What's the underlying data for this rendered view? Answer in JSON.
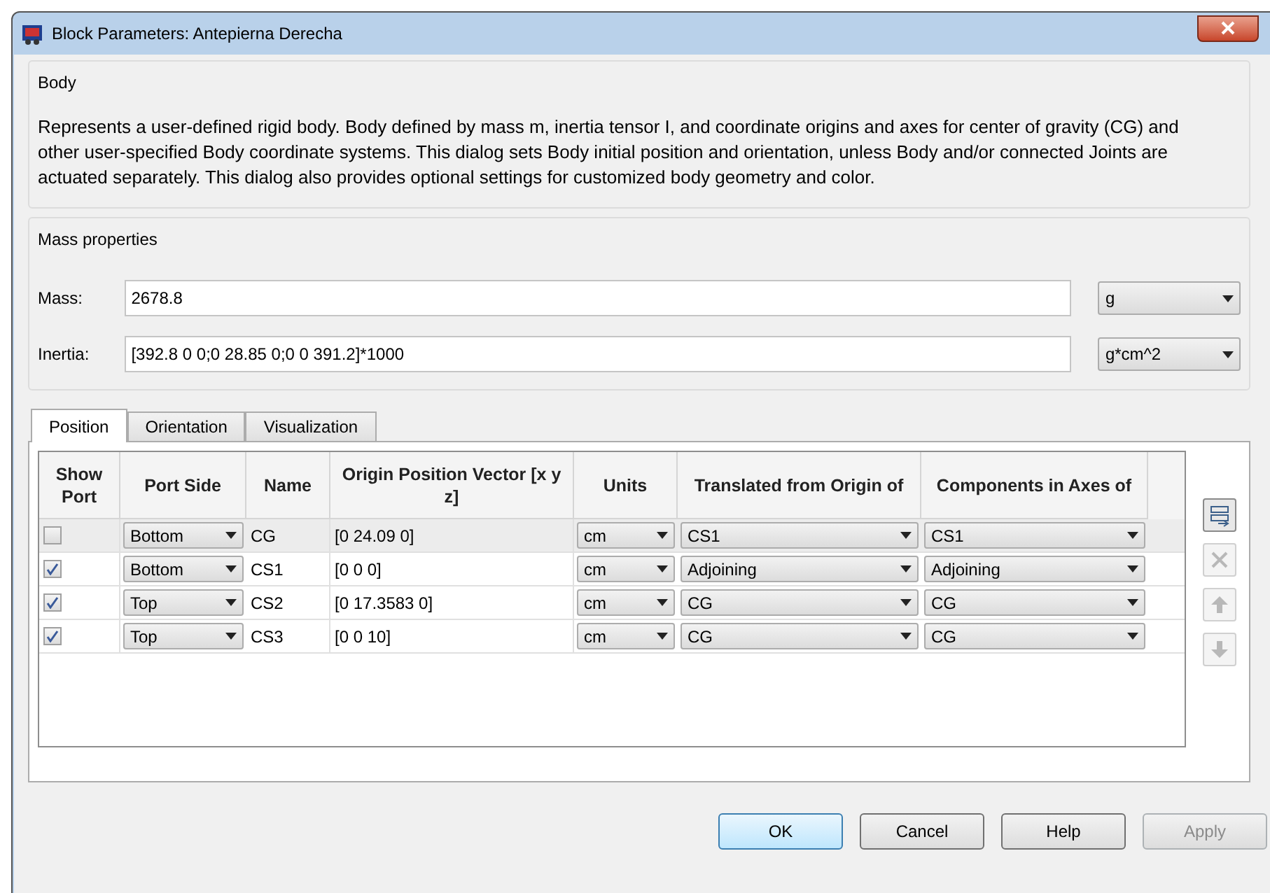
{
  "window": {
    "title": "Block Parameters: Antepierna Derecha"
  },
  "body": {
    "legend": "Body",
    "description": "Represents a user-defined rigid body. Body defined by mass m, inertia tensor I, and coordinate origins and axes for center of gravity (CG) and other user-specified Body coordinate systems. This dialog sets Body initial position and orientation, unless Body and/or connected Joints are actuated separately. This dialog also provides optional settings for customized body geometry and color."
  },
  "mass_properties": {
    "legend": "Mass properties",
    "fields": [
      {
        "label": "Mass:",
        "value": "2678.8",
        "unit": "g"
      },
      {
        "label": "Inertia:",
        "value": "[392.8 0 0;0 28.85 0;0 0 391.2]*1000",
        "unit": "g*cm^2"
      }
    ]
  },
  "tabs": [
    {
      "label": "Position",
      "selected": true
    },
    {
      "label": "Orientation",
      "selected": false
    },
    {
      "label": "Visualization",
      "selected": false
    }
  ],
  "table": {
    "columns": [
      "Show Port",
      "Port Side",
      "Name",
      "Origin Position Vector [x y z]",
      "Units",
      "Translated from Origin of",
      "Components in Axes of"
    ],
    "rows": [
      {
        "selected": true,
        "show_port": false,
        "port_side": "Bottom",
        "name": "CG",
        "origin": "[0 24.09 0]",
        "units": "cm",
        "translated_from": "CS1",
        "components_in": "CS1"
      },
      {
        "selected": false,
        "show_port": true,
        "port_side": "Bottom",
        "name": "CS1",
        "origin": "[0 0 0]",
        "units": "cm",
        "translated_from": "Adjoining",
        "components_in": "Adjoining"
      },
      {
        "selected": false,
        "show_port": true,
        "port_side": "Top",
        "name": "CS2",
        "origin": "[0 17.3583 0]",
        "units": "cm",
        "translated_from": "CG",
        "components_in": "CG"
      },
      {
        "selected": false,
        "show_port": true,
        "port_side": "Top",
        "name": "CS3",
        "origin": "[0 0 10]",
        "units": "cm",
        "translated_from": "CG",
        "components_in": "CG"
      }
    ]
  },
  "row_tools": [
    {
      "kind": "add",
      "disabled": false
    },
    {
      "kind": "delete",
      "disabled": true
    },
    {
      "kind": "up",
      "disabled": true
    },
    {
      "kind": "down",
      "disabled": true
    }
  ],
  "buttons": [
    {
      "label": "OK",
      "default": true,
      "disabled": false
    },
    {
      "label": "Cancel",
      "default": false,
      "disabled": false
    },
    {
      "label": "Help",
      "default": false,
      "disabled": false
    },
    {
      "label": "Apply",
      "default": false,
      "disabled": true
    }
  ]
}
